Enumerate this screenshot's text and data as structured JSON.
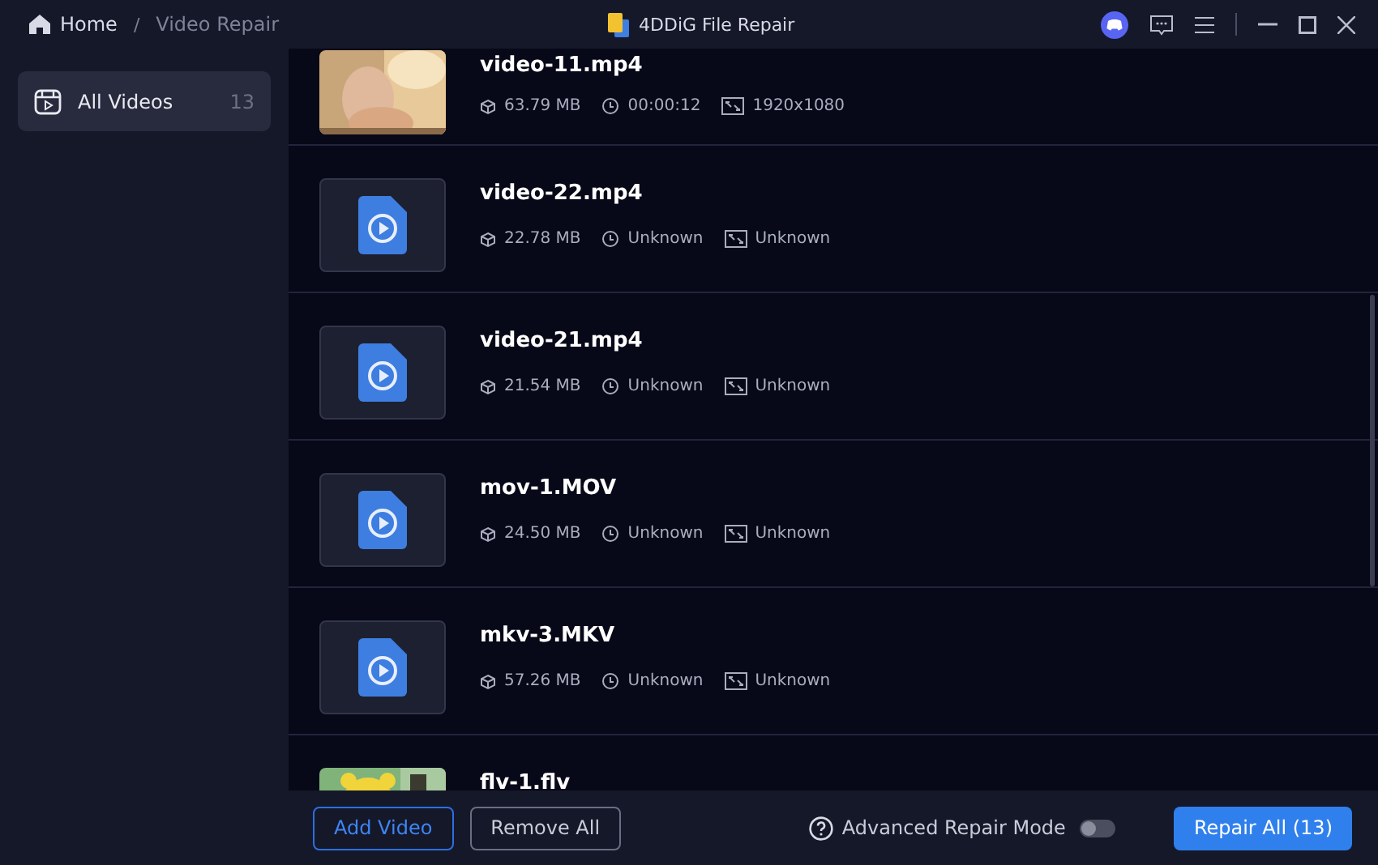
{
  "titlebar": {
    "breadcrumb": [
      {
        "label": "Home",
        "kind": "home"
      },
      {
        "label": "/",
        "kind": "separator"
      },
      {
        "label": "Video Repair",
        "kind": "current"
      }
    ],
    "app_title": "4DDiG File Repair"
  },
  "sidebar": {
    "items": [
      {
        "label": "All Videos",
        "count": "13",
        "selected": true
      }
    ]
  },
  "videos": [
    {
      "name": "video-11.mp4",
      "kind": "picture",
      "size": "63.79 MB",
      "duration": "00:00:12",
      "resolution": "1920x1080"
    },
    {
      "name": "video-22.mp4",
      "kind": "file",
      "size": "22.78 MB",
      "duration": "Unknown",
      "resolution": "Unknown"
    },
    {
      "name": "video-21.mp4",
      "kind": "file",
      "size": "21.54 MB",
      "duration": "Unknown",
      "resolution": "Unknown"
    },
    {
      "name": "mov-1.MOV",
      "kind": "file",
      "size": "24.50 MB",
      "duration": "Unknown",
      "resolution": "Unknown"
    },
    {
      "name": "mkv-3.MKV",
      "kind": "file",
      "size": "57.26 MB",
      "duration": "Unknown",
      "resolution": "Unknown"
    },
    {
      "name": "flv-1.flv",
      "kind": "picture2"
    }
  ],
  "footer": {
    "add_button": "Add Video",
    "remove_button": "Remove All",
    "advanced_mode": {
      "label": "Advanced Repair Mode",
      "on": false
    },
    "repair_button": "Repair All (13)"
  }
}
